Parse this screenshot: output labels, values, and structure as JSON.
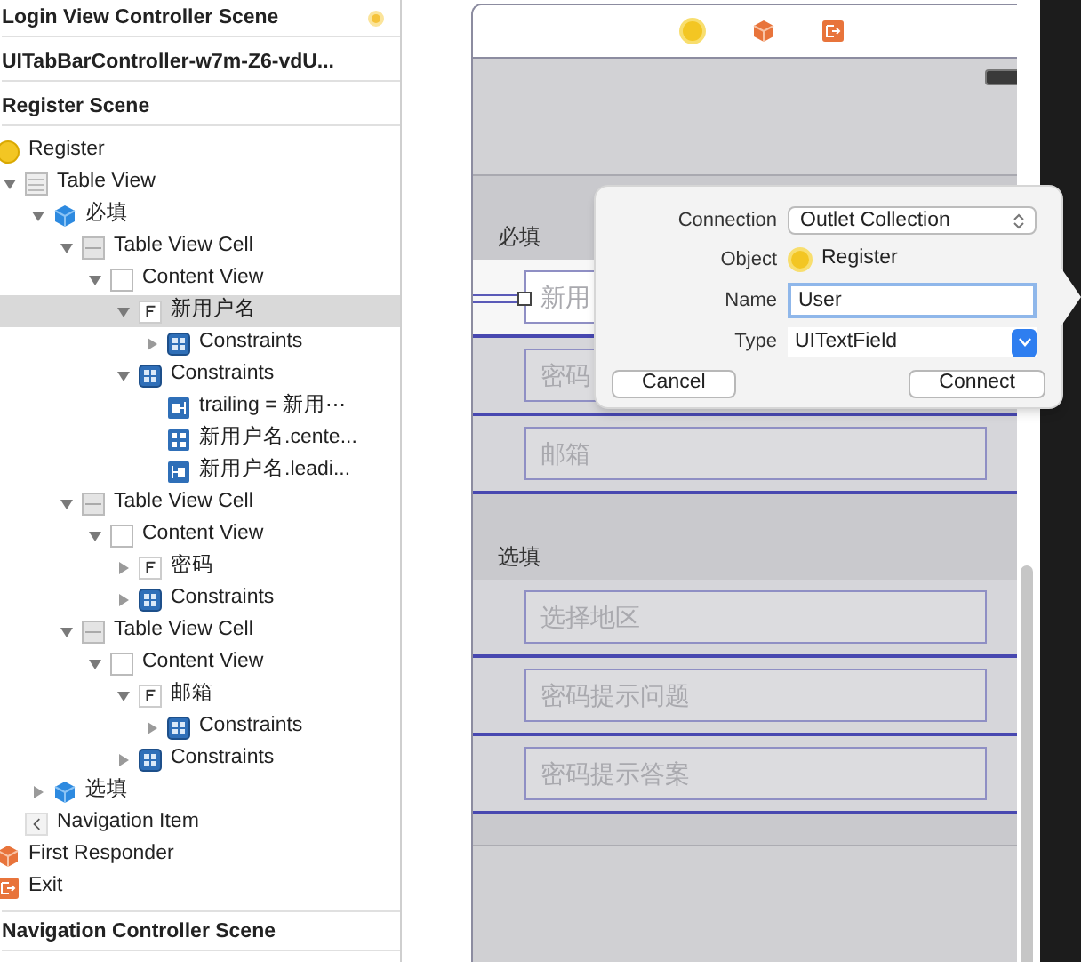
{
  "outline": {
    "scenes_top": [
      {
        "title": "Login View Controller Scene",
        "marker": true
      },
      {
        "title": "UITabBarController-w7m-Z6-vdU...",
        "marker": false
      },
      {
        "title": "Register Scene",
        "marker": false
      }
    ],
    "tree": [
      {
        "label": "Register",
        "kind": "controller",
        "selected": false,
        "children": [
          {
            "label": "Table View",
            "kind": "table",
            "expanded": true,
            "selected": false,
            "children": [
              {
                "label": "必填",
                "kind": "section",
                "expanded": true,
                "selected": false,
                "children": [
                  {
                    "label": "Table View Cell",
                    "kind": "cell",
                    "expanded": true,
                    "selected": false,
                    "children": [
                      {
                        "label": "Content View",
                        "kind": "view",
                        "expanded": true,
                        "selected": false,
                        "children": [
                          {
                            "label": "新用户名",
                            "kind": "field",
                            "expanded": true,
                            "selected": true,
                            "children": [
                              {
                                "label": "Constraints",
                                "kind": "constraints",
                                "expanded": false,
                                "selected": false
                              }
                            ]
                          },
                          {
                            "label": "Constraints",
                            "kind": "constraints",
                            "expanded": true,
                            "selected": false,
                            "children": [
                              {
                                "label": "trailing = 新用⋯",
                                "kind": "trailing",
                                "selected": false
                              },
                              {
                                "label": "新用户名.cente...",
                                "kind": "center",
                                "selected": false
                              },
                              {
                                "label": "新用户名.leadi...",
                                "kind": "leading",
                                "selected": false
                              }
                            ]
                          }
                        ]
                      }
                    ]
                  },
                  {
                    "label": "Table View Cell",
                    "kind": "cell",
                    "expanded": true,
                    "selected": false,
                    "children": [
                      {
                        "label": "Content View",
                        "kind": "view",
                        "expanded": true,
                        "selected": false,
                        "children": [
                          {
                            "label": "密码",
                            "kind": "field",
                            "expanded": false,
                            "selected": false
                          },
                          {
                            "label": "Constraints",
                            "kind": "constraints",
                            "expanded": false,
                            "selected": false
                          }
                        ]
                      }
                    ]
                  },
                  {
                    "label": "Table View Cell",
                    "kind": "cell",
                    "expanded": true,
                    "selected": false,
                    "children": [
                      {
                        "label": "Content View",
                        "kind": "view",
                        "expanded": true,
                        "selected": false,
                        "children": [
                          {
                            "label": "邮箱",
                            "kind": "field",
                            "expanded": true,
                            "selected": false,
                            "children": [
                              {
                                "label": "Constraints",
                                "kind": "constraints",
                                "expanded": false,
                                "selected": false
                              }
                            ]
                          },
                          {
                            "label": "Constraints",
                            "kind": "constraints",
                            "expanded": false,
                            "selected": false
                          }
                        ]
                      }
                    ]
                  }
                ]
              },
              {
                "label": "选填",
                "kind": "section",
                "expanded": false,
                "selected": false
              }
            ]
          },
          {
            "label": "Navigation Item",
            "kind": "nav",
            "selected": false
          }
        ]
      },
      {
        "label": "First Responder",
        "kind": "responder",
        "selected": false
      },
      {
        "label": "Exit",
        "kind": "exit",
        "selected": false
      }
    ],
    "scenes_bottom": [
      {
        "title": "Navigation Controller Scene",
        "marker": false
      }
    ]
  },
  "storyboard": {
    "sections": [
      {
        "header": "必填",
        "rows": [
          {
            "placeholder": "新用",
            "selected": true
          },
          {
            "placeholder": "密码",
            "selected": false
          },
          {
            "placeholder": "邮箱",
            "selected": false
          }
        ]
      },
      {
        "header": "选填",
        "rows": [
          {
            "placeholder": "选择地区",
            "selected": false
          },
          {
            "placeholder": "密码提示问题",
            "selected": false
          },
          {
            "placeholder": "密码提示答案",
            "selected": false
          }
        ]
      }
    ]
  },
  "popover": {
    "fields": [
      {
        "label": "Connection",
        "kind": "popup",
        "value": "Outlet Collection"
      },
      {
        "label": "Object",
        "kind": "object",
        "value": "Register"
      },
      {
        "label": "Name",
        "kind": "text",
        "value": "User"
      },
      {
        "label": "Type",
        "kind": "combo",
        "value": "UITextField"
      }
    ],
    "buttons": [
      "Cancel",
      "Connect"
    ]
  }
}
